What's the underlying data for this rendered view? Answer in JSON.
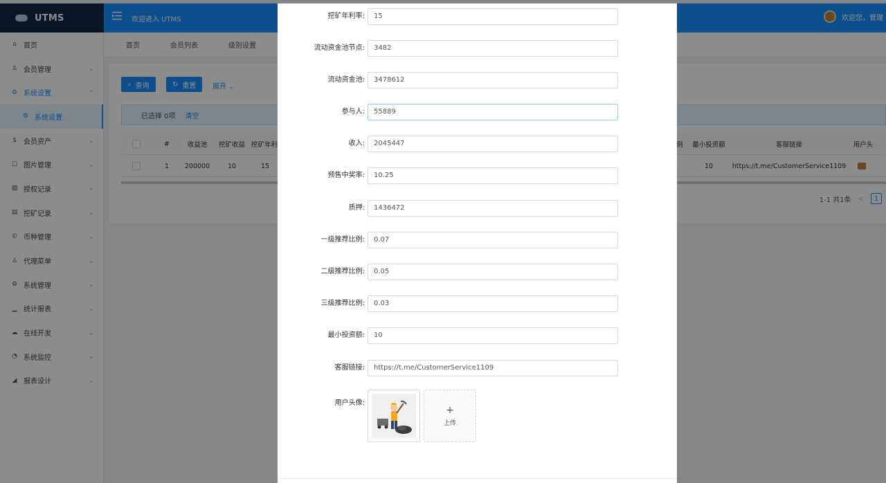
{
  "header": {
    "logo_text": "UTMS",
    "welcome": "欢迎进入 UTMS",
    "user_greeting": "欢迎您，管理"
  },
  "sidebar": {
    "items": [
      {
        "label": "首页",
        "icon": "home-icon"
      },
      {
        "label": "会员管理",
        "icon": "user-icon"
      },
      {
        "label": "系统设置",
        "icon": "gear-icon"
      },
      {
        "label": "系统设置",
        "icon": "gear-icon"
      },
      {
        "label": "会员资产",
        "icon": "dollar-icon"
      },
      {
        "label": "图片管理",
        "icon": "square-icon"
      },
      {
        "label": "授权记录",
        "icon": "image-icon"
      },
      {
        "label": "挖矿记录",
        "icon": "list-icon"
      },
      {
        "label": "币种管理",
        "icon": "copyright-icon"
      },
      {
        "label": "代理菜单",
        "icon": "user-icon"
      },
      {
        "label": "系统管理",
        "icon": "gear-icon"
      },
      {
        "label": "统计报表",
        "icon": "bar-chart-icon"
      },
      {
        "label": "在线开发",
        "icon": "cloud-icon"
      },
      {
        "label": "系统监控",
        "icon": "dashboard-icon"
      },
      {
        "label": "报表设计",
        "icon": "area-chart-icon"
      }
    ]
  },
  "tabs": [
    "首页",
    "会员列表",
    "级别设置"
  ],
  "toolbar": {
    "query": "查询",
    "reset": "重置",
    "expand": "展开"
  },
  "alert": {
    "selected": "已选择 0项",
    "clear": "清空"
  },
  "table": {
    "headers": {
      "num": "#",
      "pool": "收益池",
      "mining_income": "挖矿收益",
      "mining_rate": "挖矿年利",
      "ratio_tail": "例",
      "min_invest": "最小投资额",
      "cs_link": "客服链接",
      "avatar": "用户头"
    },
    "row": {
      "num": "1",
      "pool": "200000",
      "mining_income": "10",
      "mining_rate": "15",
      "min_invest": "10",
      "cs_link": "https://t.me/CustomerService1109"
    }
  },
  "pager": {
    "summary": "1-1 共1条",
    "prev": "<",
    "current": "1"
  },
  "form": {
    "fields": [
      {
        "label": "挖矿年利率:",
        "value": "15"
      },
      {
        "label": "流动资金池节点:",
        "value": "3482"
      },
      {
        "label": "流动资金池:",
        "value": "3478612"
      },
      {
        "label": "参与人:",
        "value": "55889"
      },
      {
        "label": "收入:",
        "value": "2045447"
      },
      {
        "label": "预售中奖率:",
        "value": "10.25"
      },
      {
        "label": "质押:",
        "value": "1436472"
      },
      {
        "label": "一级推荐比例:",
        "value": "0.07"
      },
      {
        "label": "二级推荐比例:",
        "value": "0.05"
      },
      {
        "label": "三级推荐比例:",
        "value": "0.03"
      },
      {
        "label": "最小投资额:",
        "value": "10"
      },
      {
        "label": "客服链接:",
        "value": "https://t.me/CustomerService1109"
      }
    ],
    "avatar_label": "用户头像:",
    "upload_plus": "+",
    "upload_text": "上传"
  },
  "colors": {
    "primary": "#1890ff",
    "logo_bg": "#0f2944",
    "overlay": "rgba(0,0,0,0.45)"
  }
}
